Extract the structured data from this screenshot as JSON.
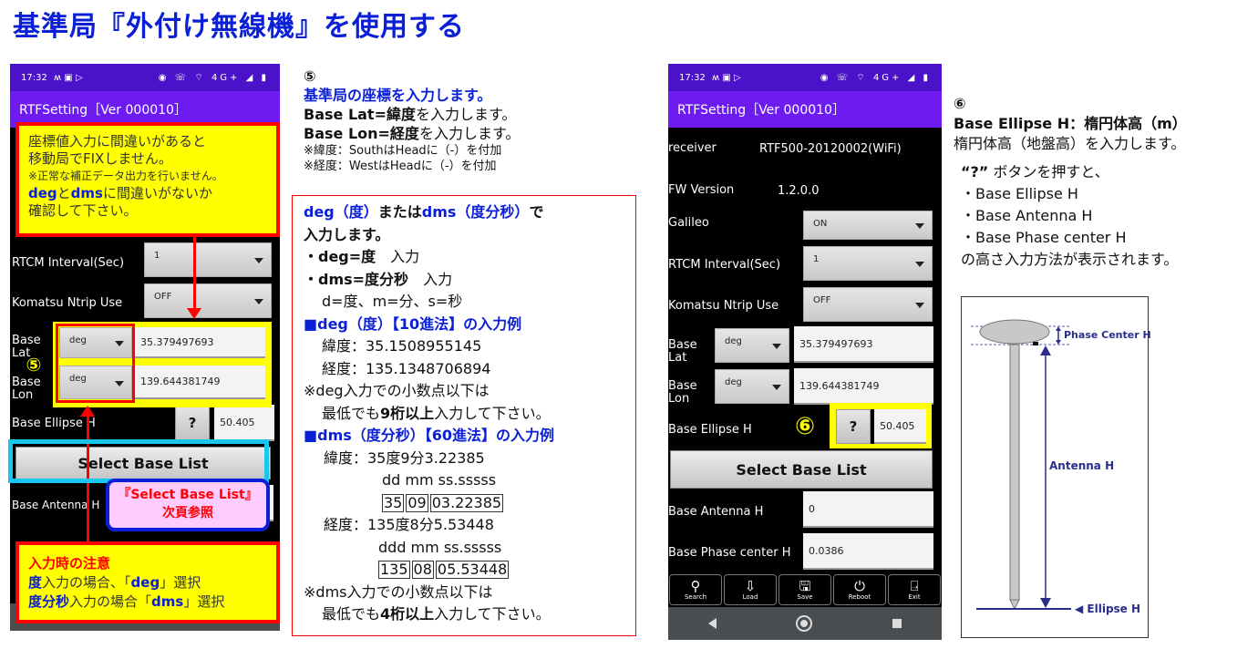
{
  "page_title": "基準局『外付け無線機』を使用する",
  "left_phone": {
    "status_time": "17:32",
    "status_left_icons": "ʍ ▣ ▷",
    "status_right_icons": "◉ ☏ ⌔ 4G+ ◢ ▮",
    "app_title": "RTFSetting［Ver 000010］",
    "rows": {
      "rtcm_interval_label": "RTCM Interval(Sec)",
      "rtcm_interval_value": "1",
      "komatsu_label": "Komatsu Ntrip Use",
      "komatsu_value": "OFF",
      "base_lat_label": "Base\nLat",
      "base_lat_format": "deg",
      "base_lat_value": "35.379497693",
      "base_lon_label": "Base\nLon",
      "base_lon_format": "deg",
      "base_lon_value": "139.644381749",
      "ellipse_label": "Base Ellipse H",
      "ellipse_help": "?",
      "ellipse_value": "50.405",
      "select_base_list": "Select Base List",
      "antenna_label": "Base Antenna H"
    },
    "marker": "⑤",
    "warning_callout": {
      "line1": "座標値入力に間違いがあると",
      "line2": "移動局でFIXしません。",
      "line3": "※正常な補正データ出力を行いません。",
      "line4_deg": "deg",
      "line4_to": "と",
      "line4_dms": "dms",
      "line4_rest": "に間違いがないか",
      "line5": "確認して下さい。"
    },
    "select_list_callout": {
      "line1": "『Select Base List』",
      "line2": "次頁参照"
    },
    "input_note_callout": {
      "title": "入力時の注意",
      "l1_bold": "度",
      "l1_rest": "入力の場合、「",
      "l1_key": "deg",
      "l1_end": "」選択",
      "l2_bold": "度分秒",
      "l2_rest": "入力の場合「",
      "l2_key": "dms",
      "l2_end": "」選択"
    }
  },
  "step5": {
    "number": "⑤",
    "heading": "基準局の座標を入力します。",
    "lat_bold": "Base Lat=緯度",
    "lat_rest": "を入力します。",
    "lon_bold": "Base Lon=経度",
    "lon_rest": "を入力します。",
    "note_south": "※緯度：SouthはHeadに（-）を付加",
    "note_west": "※経度：WestはHeadに（-）を付加",
    "box": {
      "intro_deg": "deg（度）",
      "intro_mid": "または",
      "intro_dms": "dms（度分秒）",
      "intro_end": "で",
      "intro_line2": "入力します。",
      "bullet_deg_bold": "・deg=度",
      "bullet_deg_rest": "　入力",
      "bullet_dms_bold": "・dms=度分秒",
      "bullet_dms_rest": "　入力",
      "dms_legend": "d=度、m=分、s=秒",
      "deg_example_title": "■deg（度）【10進法】の入力例",
      "deg_lat": "緯度：35.1508955145",
      "deg_lon": "経度：135.1348706894",
      "deg_note1": "※deg入力での小数点以下は",
      "deg_note2_a": "最低でも",
      "deg_note2_b": "9桁以上",
      "deg_note2_c": "入力して下さい。",
      "dms_example_title": "■dms（度分秒）【60進法】の入力例",
      "dms_lat": "緯度：35度9分3.22385",
      "dms_lat_format": "dd mm ss.sssss",
      "dms_lat_parts": [
        "35",
        "09",
        "03.22385"
      ],
      "dms_lon": "経度：135度8分5.53448",
      "dms_lon_format": "ddd mm ss.sssss",
      "dms_lon_parts": [
        "135",
        "08",
        "05.53448"
      ],
      "dms_note1": "※dms入力での小数点以下は",
      "dms_note2_a": "最低でも",
      "dms_note2_b": "4桁以上",
      "dms_note2_c": "入力して下さい。"
    }
  },
  "right_phone": {
    "status_time": "17:32",
    "status_left_icons": "ʍ ▣ ▷",
    "status_right_icons": "◉ ☏ ⌔ 4G+ ◢ ▮",
    "app_title": "RTFSetting［Ver 000010］",
    "rows": {
      "receiver_label": "receiver",
      "receiver_value": "RTF500-20120002(WiFi)",
      "fw_label": "FW Version",
      "fw_value": "1.2.0.0",
      "galileo_label": "Galileo",
      "galileo_value": "ON",
      "rtcm_interval_label": "RTCM Interval(Sec)",
      "rtcm_interval_value": "1",
      "komatsu_label": "Komatsu Ntrip Use",
      "komatsu_value": "OFF",
      "base_lat_label": "Base\nLat",
      "base_lat_format": "deg",
      "base_lat_value": "35.379497693",
      "base_lon_label": "Base\nLon",
      "base_lon_format": "deg",
      "base_lon_value": "139.644381749",
      "ellipse_label": "Base Ellipse H",
      "ellipse_help": "?",
      "ellipse_value": "50.405",
      "select_base_list": "Select Base List",
      "antenna_label": "Base Antenna H",
      "antenna_value": "0",
      "phase_label": "Base Phase center H",
      "phase_value": "0.0386"
    },
    "marker": "⑥",
    "toolbar": [
      {
        "icon": "search-icon",
        "glyph": "⚲",
        "label": "Search"
      },
      {
        "icon": "load-icon",
        "glyph": "⇩",
        "label": "Load"
      },
      {
        "icon": "save-icon",
        "glyph": "🖫",
        "label": "Save"
      },
      {
        "icon": "power-icon",
        "glyph": "⏻",
        "label": "Reboot"
      },
      {
        "icon": "exit-icon",
        "glyph": "⍈",
        "label": "Exit"
      }
    ]
  },
  "step6": {
    "number": "⑥",
    "heading": "Base Ellipse H：楕円体高（m）",
    "sub": "楕円体高（地盤高）を入力します。",
    "q_quote": "“?”",
    "q_rest": " ボタンを押すと、",
    "items": [
      "・Base Ellipse H",
      "・Base Antenna H",
      "・Base Phase center H"
    ],
    "tail": "の高さ入力方法が表示されます。"
  },
  "diagram": {
    "phase_center_label": "Phase Center H",
    "antenna_label": "Antenna H",
    "ellipse_label": "◀ Ellipse H",
    "color": "#2b2d8c"
  }
}
